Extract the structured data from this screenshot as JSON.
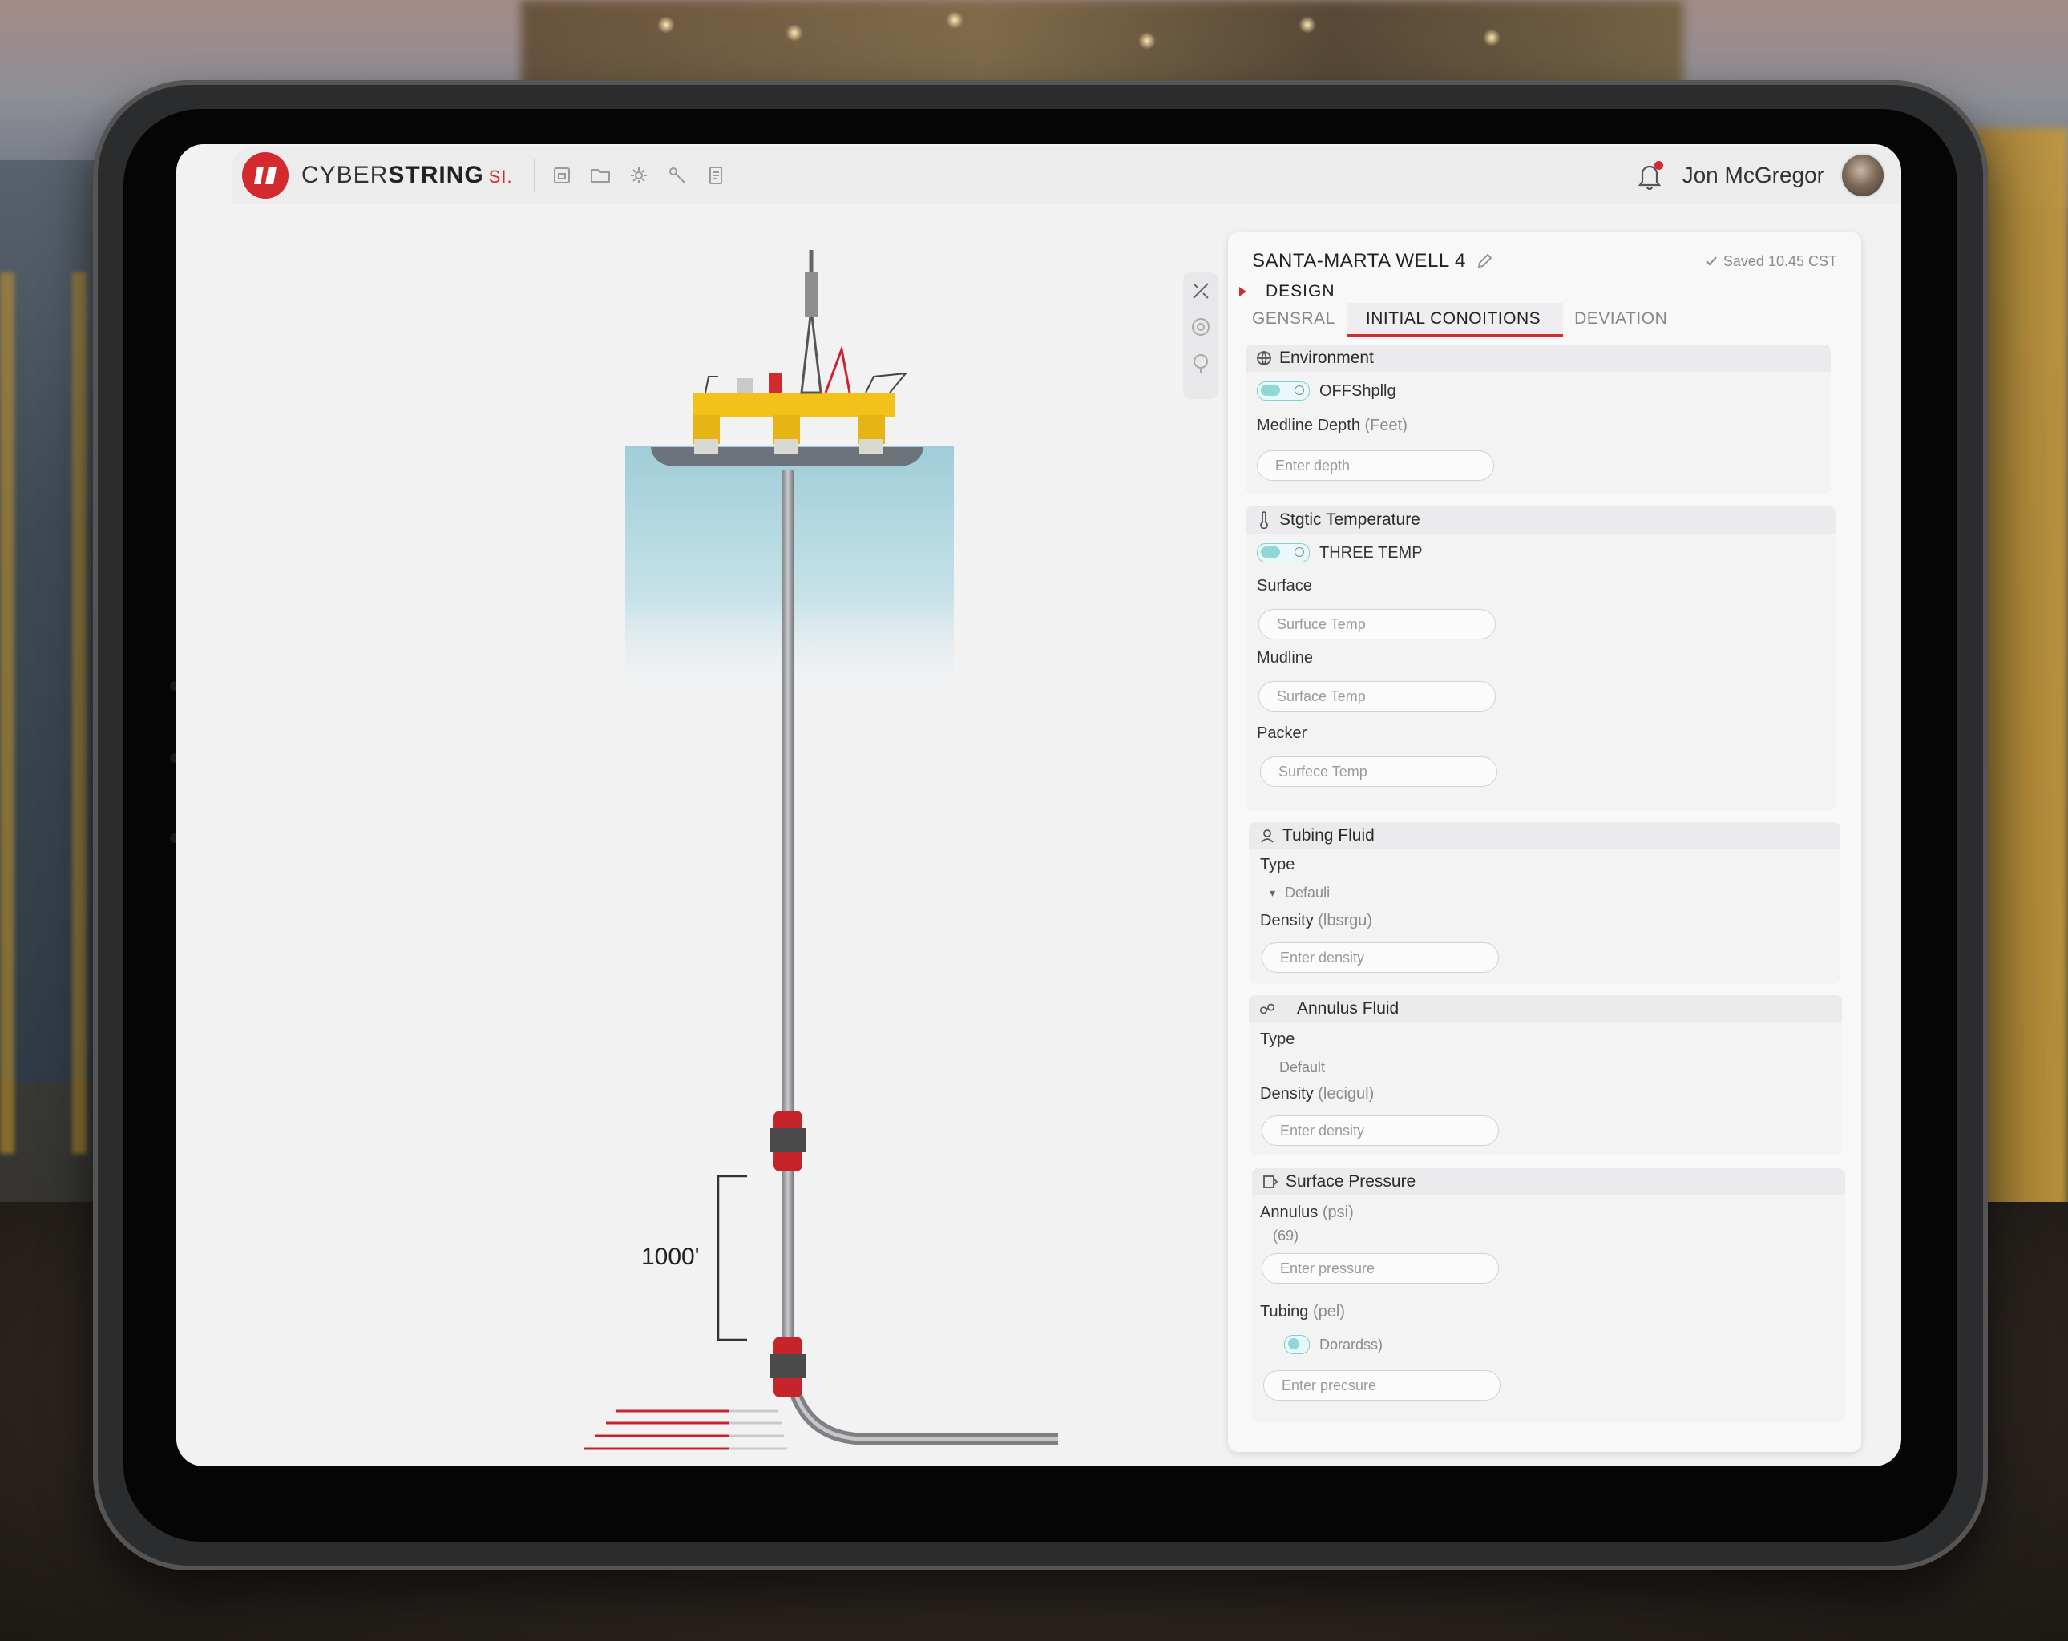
{
  "app": {
    "brand_light": "CYBER",
    "brand_bold": "STRING",
    "brand_suffix": "SI."
  },
  "header": {
    "user_name": "Jon McGregor",
    "toolbar_icons": [
      "save-icon",
      "folder-icon",
      "settings-icon",
      "tools-icon",
      "document-icon"
    ]
  },
  "well": {
    "name": "SANTA-MARTA WELL 4",
    "saved_status": "Saved 10.45 CST",
    "section": "DESIGN"
  },
  "tabs": [
    {
      "label": "GENSRAL",
      "active": false
    },
    {
      "label": "INITIAL CONOITIONS",
      "active": true
    },
    {
      "label": "DEVIATION",
      "active": false
    }
  ],
  "environment": {
    "title": "Environment",
    "toggle_label": "OFFShpllg",
    "mudline_label": "Medline Depth",
    "mudline_unit": "(Feet)",
    "mudline_placeholder": "Enter depth"
  },
  "static_temperature": {
    "title": "Stgtic Temperature",
    "toggle_label": "THREE TEMP",
    "surface_label": "Surface",
    "surface_placeholder": "Surfuce Temp",
    "mudline_label": "Mudline",
    "mudline_placeholder": "Surface Temp",
    "packer_label": "Packer",
    "packer_placeholder": "Surfece Temp"
  },
  "tubing_fluid": {
    "title": "Tubing Fluid",
    "type_label": "Type",
    "type_value": "Defauli",
    "density_label": "Density",
    "density_unit": "(lbsrgu)",
    "density_placeholder": "Enter density"
  },
  "annulus_fluid": {
    "title": "Annulus Fluid",
    "type_label": "Type",
    "type_value": "Default",
    "density_label": "Density",
    "density_unit": "(lecigul)",
    "density_placeholder": "Enter density"
  },
  "surface_pressure": {
    "title": "Surface Pressure",
    "annulus_label": "Annulus",
    "annulus_unit": "(psi)",
    "annulus_value": "(69)",
    "annulus_placeholder": "Enter pressure",
    "tubing_label": "Tubing",
    "tubing_unit": "(pel)",
    "tubing_toggle_label": "Dorardss)",
    "tubing_placeholder": "Enter precsure"
  },
  "visualization": {
    "depth_label": "1000'"
  },
  "colors": {
    "accent": "#d22a2f",
    "rig_yellow": "#f2c21a",
    "toggle_teal": "#8fd8d6",
    "water": "#a9d3dc"
  }
}
